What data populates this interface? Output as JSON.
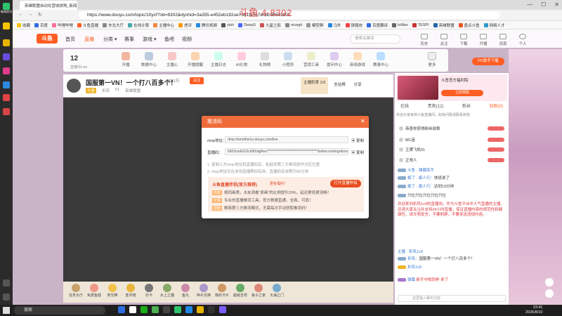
{
  "browser": {
    "tab_title": "英雄联盟自动化营收拼购_新闻…",
    "url": "https://www.douyu.com/topic/10ycf?rid=8302&dyshid=3a355-e452eb192ue7381fa7e7e0dc06041601",
    "watermark": "斗鱼 4·8302",
    "bookmarks": [
      "收藏",
      "百度",
      "哔哩哔哩",
      "斗鱼直播",
      "东北大厅",
      "在线计算",
      "主播中心",
      "虎牙",
      "腾讯视频",
      "ytzh",
      "DeepS",
      "九星之影",
      "nicegit",
      "模型群",
      "马外",
      "铁路信",
      "百度翻译",
      "loMax",
      "TESPI",
      "英雄联盟",
      "盘点斗鱼",
      "网络人才"
    ],
    "win_controls": [
      "—",
      "☐",
      "✕"
    ]
  },
  "rail": {
    "badge": "新闻资讯"
  },
  "header": {
    "logo": "斗鱼",
    "nav": [
      "首页",
      "直播",
      "分类 ▾",
      "赛事",
      "游戏 ▾",
      "鱼吧",
      "视频"
    ],
    "search_placeholder": "搜索关键词",
    "icons": [
      "历史",
      "关注",
      "下载",
      "开播",
      "消息",
      "个人"
    ]
  },
  "categories": {
    "count": "12",
    "count_label": "直播中Live",
    "items": [
      "开播",
      "数据中心",
      "主播心",
      "开播提醒",
      "主播日志",
      "AI礼物",
      "礼物榜",
      "小程序",
      "营销工具",
      "提问中心",
      "新闻游戏",
      "赛事中心",
      "更多"
    ],
    "pc_button": "PC助手下载"
  },
  "stream": {
    "title": "国服第一VN！一个打八百多个！",
    "hot": "3011万",
    "follow": "关注",
    "meta": [
      "斗鱼",
      "折风",
      "61",
      "英雄联盟"
    ],
    "card1": "主播奶茶 1/3",
    "card2": "全站榜",
    "card3": "分享"
  },
  "gifts": [
    "任务大厅",
    "免费鱼翅",
    "荧光棒",
    "金币榜",
    "办卡",
    "水上之猫",
    "鱼丸",
    "碎片兑换",
    "我的卡片",
    "超级吉祥",
    "兔子之家",
    "大海之门"
  ],
  "right": {
    "banner_title": "斗鱼官方福利院",
    "banner_btn": "立即领取",
    "tabs": [
      "在线",
      "贵宾(12)",
      "粉丝",
      "钻粉(0)"
    ],
    "notice": "欢迎大家来到斗鱼直播间，如有问题请联系房管",
    "users": [
      "恭喜你获得粉丝勋章",
      "MC苗",
      "王牌飞机01",
      "正常人"
    ],
    "chat": [
      {
        "name": "斗鱼 · 弹幕助手",
        "text": ""
      },
      {
        "name": "痴了 · 痴人行：",
        "text": "快说说了"
      },
      {
        "name": "痴了 · 痴人行：",
        "text": "达到13分钟"
      },
      {
        "name": "",
        "text": "只仕只仕只仕只仕只仕"
      },
      {
        "name": "",
        "text": "欢迎来到折风1v9的直播间。作为斗鱼平台中人气直播的主播，还请大家关注并支持24小时直播，保证直播内容的规范性和健康性，请文明发言，不要刷屏，不要发送违规内容。"
      },
      {
        "name": "主播 · 折风1v9",
        "text": ""
      },
      {
        "name": "折风：",
        "text": "国服第一VN！一个打八百多个！"
      },
      {
        "name": "折风1v9",
        "text": ""
      },
      {
        "name": "弹幕",
        "text": "新手中相同样 来了"
      }
    ],
    "input_placeholder": "这里输入聊天内容"
  },
  "modal": {
    "title": "推流码",
    "rtmp_label": "rtmp地址：",
    "rtmp_value": "rtmp://sendhw1a.douyu.com/live",
    "key_label": "直播码：",
    "key_value": "8302vxdGC0ci08XdgReu*************************************&direccomingrdonv0",
    "copy": "复制",
    "note1": "1. 复制上方rtmp地址和直播码后，粘贴到第三方推流软件对应位置",
    "note2": "2. rtmp地址仅在本场直播期间有效，直播码有效期为90分钟",
    "promo_title": "斗鱼直播伴侣(官方推荐)",
    "promo_sub": "更有福利！",
    "promo_btn": "打开直播伴侣",
    "promo_rows": [
      {
        "tag": "高效",
        "text": "相同画质，水友观看“原画”的比例提升20%，延迟更低更流畅！"
      },
      {
        "tag": "可靠",
        "text": "专业的直播推流工具，官方数据直通，全面，可靠！"
      },
      {
        "tag": "便捷",
        "text": "精简第三方推流模式，无需每次手动获取推流码！"
      }
    ]
  },
  "taskbar": {
    "search": "搜索",
    "time": "23:41",
    "date": "2026/8/10"
  }
}
